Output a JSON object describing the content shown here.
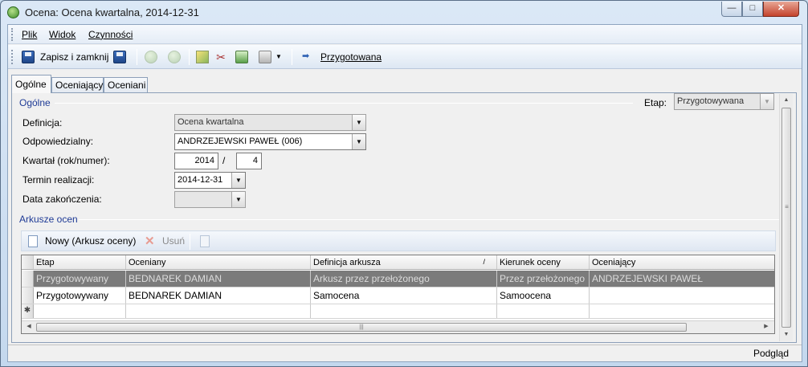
{
  "window": {
    "title": "Ocena: Ocena kwartalna, 2014-12-31",
    "min_glyph": "—",
    "max_glyph": "□",
    "close_glyph": "✕"
  },
  "menu": [
    "Plik",
    "Widok",
    "Czynności"
  ],
  "toolbar": {
    "save_close": "Zapisz i zamknij",
    "status": "Przygotowana"
  },
  "tabs": [
    "Ogólne",
    "Oceniający",
    "Oceniani"
  ],
  "general": {
    "section_title": "Ogólne",
    "etap_label": "Etap:",
    "etap_value": "Przygotowywana",
    "definicja_label": "Definicja:",
    "definicja_value": "Ocena kwartalna",
    "odpowiedzialny_label": "Odpowiedzialny:",
    "odpowiedzialny_value": "ANDRZEJEWSKI PAWEŁ (006)",
    "kwartal_label": "Kwartał (rok/numer):",
    "kwartal_rok": "2014",
    "kwartal_sep": "/",
    "kwartal_numer": "4",
    "termin_label": "Termin realizacji:",
    "termin_value": "2014-12-31",
    "data_zak_label": "Data zakończenia:",
    "data_zak_value": ""
  },
  "sheets": {
    "section_title": "Arkusze ocen",
    "new_button": "Nowy (Arkusz oceny)",
    "delete_button": "Usuń",
    "columns": [
      "Etap",
      "Oceniany",
      "Definicja arkusza",
      "Kierunek oceny",
      "Oceniający"
    ],
    "sort_glyph": "/",
    "rows": [
      [
        "Przygotowywany",
        "BEDNAREK DAMIAN",
        "Arkusz przez przełożonego",
        "Przez przełożonego",
        "ANDRZEJEWSKI PAWEŁ"
      ],
      [
        "Przygotowywany",
        "BEDNAREK DAMIAN",
        "Samocena",
        "Samoocena",
        ""
      ]
    ],
    "new_row_glyph": "✱"
  },
  "statusbar": {
    "preview": "Podgląd"
  },
  "colors": {
    "group_title": "#1f3b96",
    "selected_row": "#7b7b7b",
    "toolbar_icon": "#2f62b4"
  }
}
